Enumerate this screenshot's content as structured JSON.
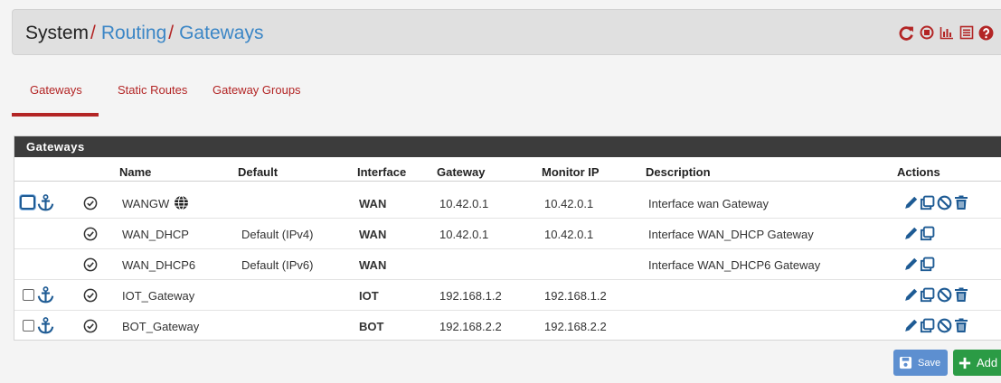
{
  "breadcrumb": {
    "system": "System",
    "sep1": "/",
    "routing": "Routing",
    "sep2": "/",
    "gateways": "Gateways"
  },
  "top_icons": [
    "reload-icon",
    "stop-icon",
    "chart-icon",
    "list-icon",
    "help-icon"
  ],
  "tabs": [
    {
      "label": "Gateways",
      "active": true
    },
    {
      "label": "Static Routes",
      "active": false
    },
    {
      "label": "Gateway Groups",
      "active": false
    }
  ],
  "panel": {
    "title": "Gateways",
    "columns": [
      "Name",
      "Default",
      "Interface",
      "Gateway",
      "Monitor IP",
      "Description",
      "Actions"
    ]
  },
  "rows": [
    {
      "name": "WANGW",
      "default": "",
      "interface": "WAN",
      "gateway": "10.42.0.1",
      "monitor": "10.42.0.1",
      "description": "Interface wan Gateway",
      "globe": true,
      "checkbox": true,
      "focused": true,
      "actions": [
        "edit",
        "copy",
        "disable",
        "delete"
      ]
    },
    {
      "name": "WAN_DHCP",
      "default": "Default (IPv4)",
      "interface": "WAN",
      "gateway": "10.42.0.1",
      "monitor": "10.42.0.1",
      "description": "Interface WAN_DHCP Gateway",
      "checkbox": false,
      "actions": [
        "edit",
        "copy"
      ]
    },
    {
      "name": "WAN_DHCP6",
      "default": "Default (IPv6)",
      "interface": "WAN",
      "gateway": "",
      "monitor": "",
      "description": "Interface WAN_DHCP6 Gateway",
      "checkbox": false,
      "actions": [
        "edit",
        "copy"
      ]
    },
    {
      "name": "IOT_Gateway",
      "default": "",
      "interface": "IOT",
      "gateway": "192.168.1.2",
      "monitor": "192.168.1.2",
      "description": "",
      "checkbox": true,
      "actions": [
        "edit",
        "copy",
        "disable",
        "delete"
      ]
    },
    {
      "name": "BOT_Gateway",
      "default": "",
      "interface": "BOT",
      "gateway": "192.168.2.2",
      "monitor": "192.168.2.2",
      "description": "",
      "checkbox": true,
      "actions": [
        "edit",
        "copy",
        "disable",
        "delete"
      ]
    }
  ],
  "buttons": {
    "save": "Save",
    "add": "Add"
  },
  "colors": {
    "accent_red": "#b32525",
    "link_blue": "#3b86c6",
    "icon_blue": "#1e5b94",
    "save_blue": "#5d8fd0",
    "add_green": "#2b9b45"
  }
}
